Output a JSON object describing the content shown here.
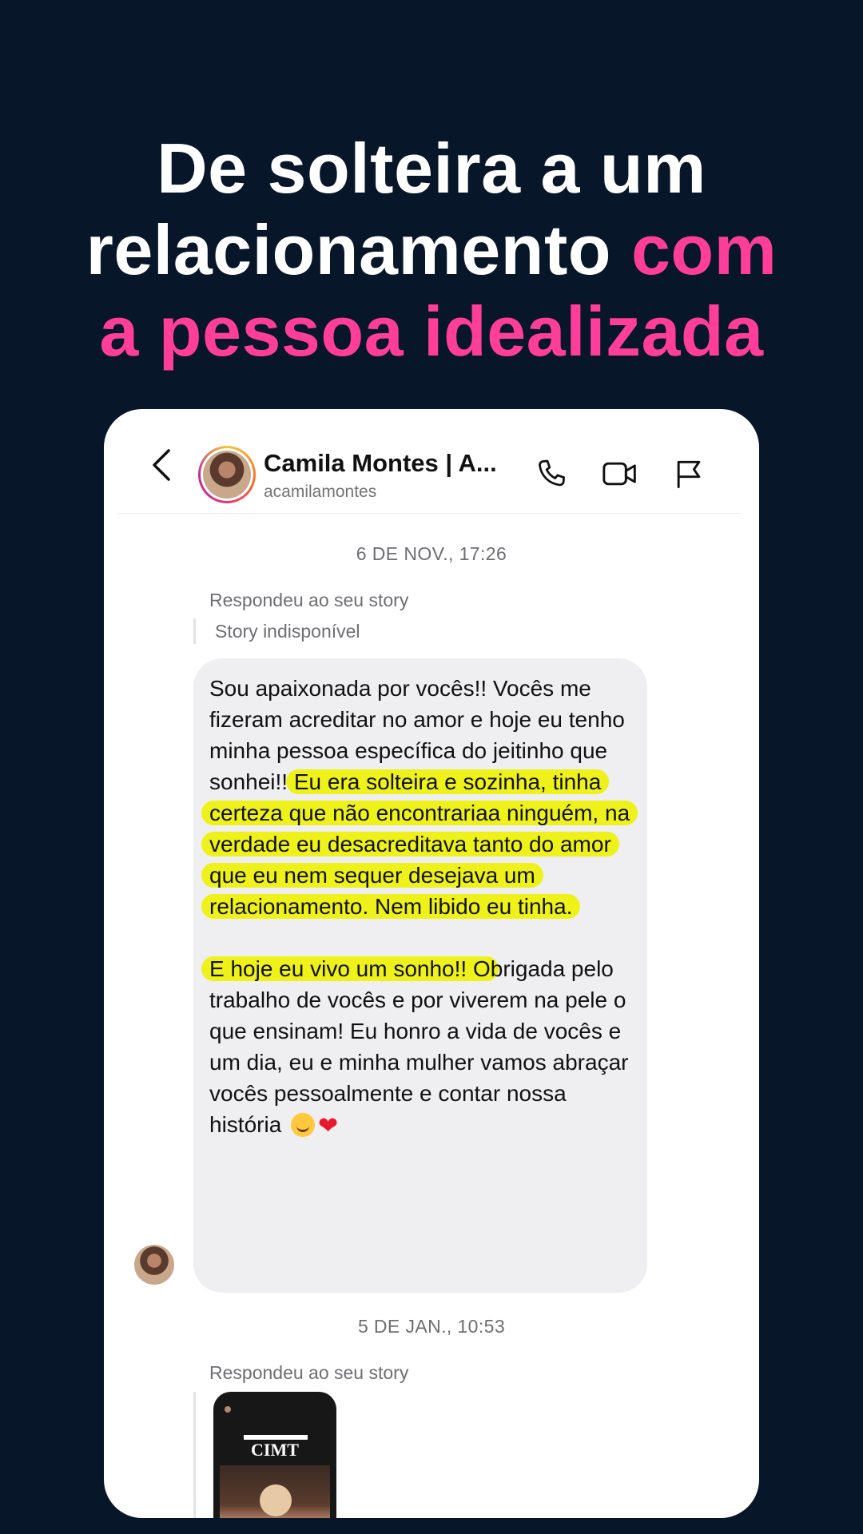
{
  "headline": {
    "line1": "De solteira a um",
    "line2_white": "relacionamento",
    "line2_pink": "com",
    "line3_pink": "a pessoa idealizada"
  },
  "chat": {
    "header": {
      "back_icon": "chevron-left-icon",
      "name": "Camila Montes | A...",
      "handle": "acamilamontes",
      "icons": [
        "phone-icon",
        "video-icon",
        "flag-icon"
      ]
    },
    "timestamp1": "6 DE NOV., 17:26",
    "reply_label1": "Respondeu ao seu story",
    "story_unavailable": "Story indisponível",
    "message": {
      "p1": "Sou apaixonada por vocês!! Vocês me fizeram acreditar no amor e hoje eu tenho minha pessoa específica do jeitinho que sonhei!!",
      "p1_highlight": "Eu era solteira e sozinha, tinha certeza que não encontrariaa ninguém, na verdade eu desacreditava tanto do amor que eu nem sequer desejava um relacionamento. Nem libido eu tinha.",
      "p2_highlight": "E hoje eu vivo um sonho!! O",
      "p2_rest": "brigada pelo trabalho de vocês e por viverem na pele o que ensinam! Eu honro a vida de vocês e um dia, eu e minha mulher vamos abraçar vocês pessoalmente e contar nossa história"
    },
    "timestamp2": "5 DE JAN., 10:53",
    "reply_label2": "Respondeu ao seu story",
    "story_thumb": {
      "brand": "CIMT"
    }
  },
  "colors": {
    "background": "#08162a",
    "accent_pink": "#ff3e9a",
    "highlight_yellow": "#eef11a",
    "bubble": "#efeff1"
  }
}
